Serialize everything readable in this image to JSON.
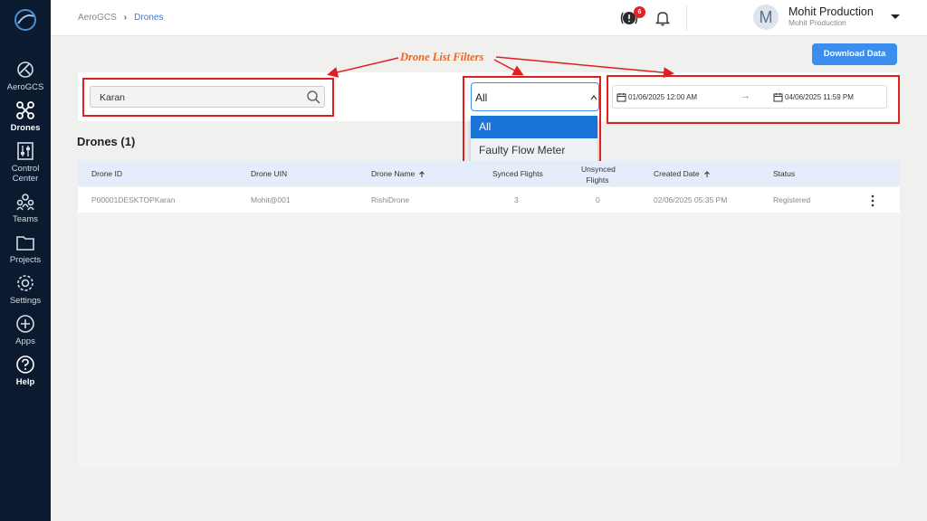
{
  "sidebar": {
    "items": [
      {
        "label": "AeroGCS"
      },
      {
        "label": "Drones"
      },
      {
        "label": "Control Center"
      },
      {
        "label": "Teams"
      },
      {
        "label": "Projects"
      },
      {
        "label": "Settings"
      },
      {
        "label": "Apps"
      },
      {
        "label": "Help"
      }
    ]
  },
  "header": {
    "breadcrumb": [
      "AeroGCS",
      "Drones"
    ],
    "notification_count": "6",
    "user": {
      "name": "Mohit Production",
      "org": "Mohit Production",
      "initial": "M"
    }
  },
  "toolbar": {
    "download_label": "Download Data"
  },
  "filters": {
    "annotation_title": "Drone List Filters",
    "search_value": "Karan",
    "status_select": {
      "value": "All",
      "options": [
        "All",
        "Faulty Flow Meter"
      ]
    },
    "date_range": {
      "start": "01/06/2025  12:00 AM",
      "end": "04/06/2025  11:59 PM"
    }
  },
  "drones": {
    "title": "Drones (1)",
    "columns": [
      "Drone ID",
      "Drone UIN",
      "Drone Name",
      "Synced Flights",
      "Unsynced Flights",
      "Created Date",
      "Status"
    ],
    "rows": [
      {
        "id": "P00001DESKTOPKaran",
        "uin": "Mohit@001",
        "name": "RishiDrone",
        "synced": "3",
        "unsynced": "0",
        "created": "02/06/2025 05:35 PM",
        "status": "Registered"
      }
    ]
  },
  "colors": {
    "sidebar_bg": "#0b1a2e",
    "accent": "#3b8eed",
    "annotation": "#e02020"
  }
}
